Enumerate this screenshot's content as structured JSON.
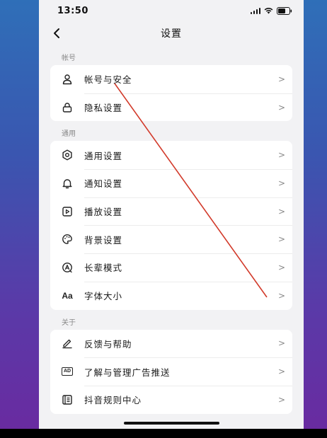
{
  "status": {
    "time": "13:50"
  },
  "nav": {
    "title": "设置",
    "back_icon": "chevron-left-icon"
  },
  "sections": [
    {
      "label": "帐号",
      "items": [
        {
          "label": "帐号与安全",
          "icon": "user-icon"
        },
        {
          "label": "隐私设置",
          "icon": "lock-icon"
        }
      ]
    },
    {
      "label": "通用",
      "items": [
        {
          "label": "通用设置",
          "icon": "gear-icon"
        },
        {
          "label": "通知设置",
          "icon": "bell-icon"
        },
        {
          "label": "播放设置",
          "icon": "play-icon"
        },
        {
          "label": "背景设置",
          "icon": "palette-icon"
        },
        {
          "label": "长辈模式",
          "icon": "elder-mode-icon"
        },
        {
          "label": "字体大小",
          "icon": "font-size-icon",
          "icon_text": "Aa"
        }
      ]
    },
    {
      "label": "关于",
      "items": [
        {
          "label": "反馈与帮助",
          "icon": "pencil-icon"
        },
        {
          "label": "了解与管理广告推送",
          "icon": "ad-icon",
          "icon_text": "AD"
        },
        {
          "label": "抖音规则中心",
          "icon": "rules-icon"
        }
      ]
    }
  ],
  "chevron": ">",
  "colors": {
    "annotation_line": "#d23a2a"
  }
}
